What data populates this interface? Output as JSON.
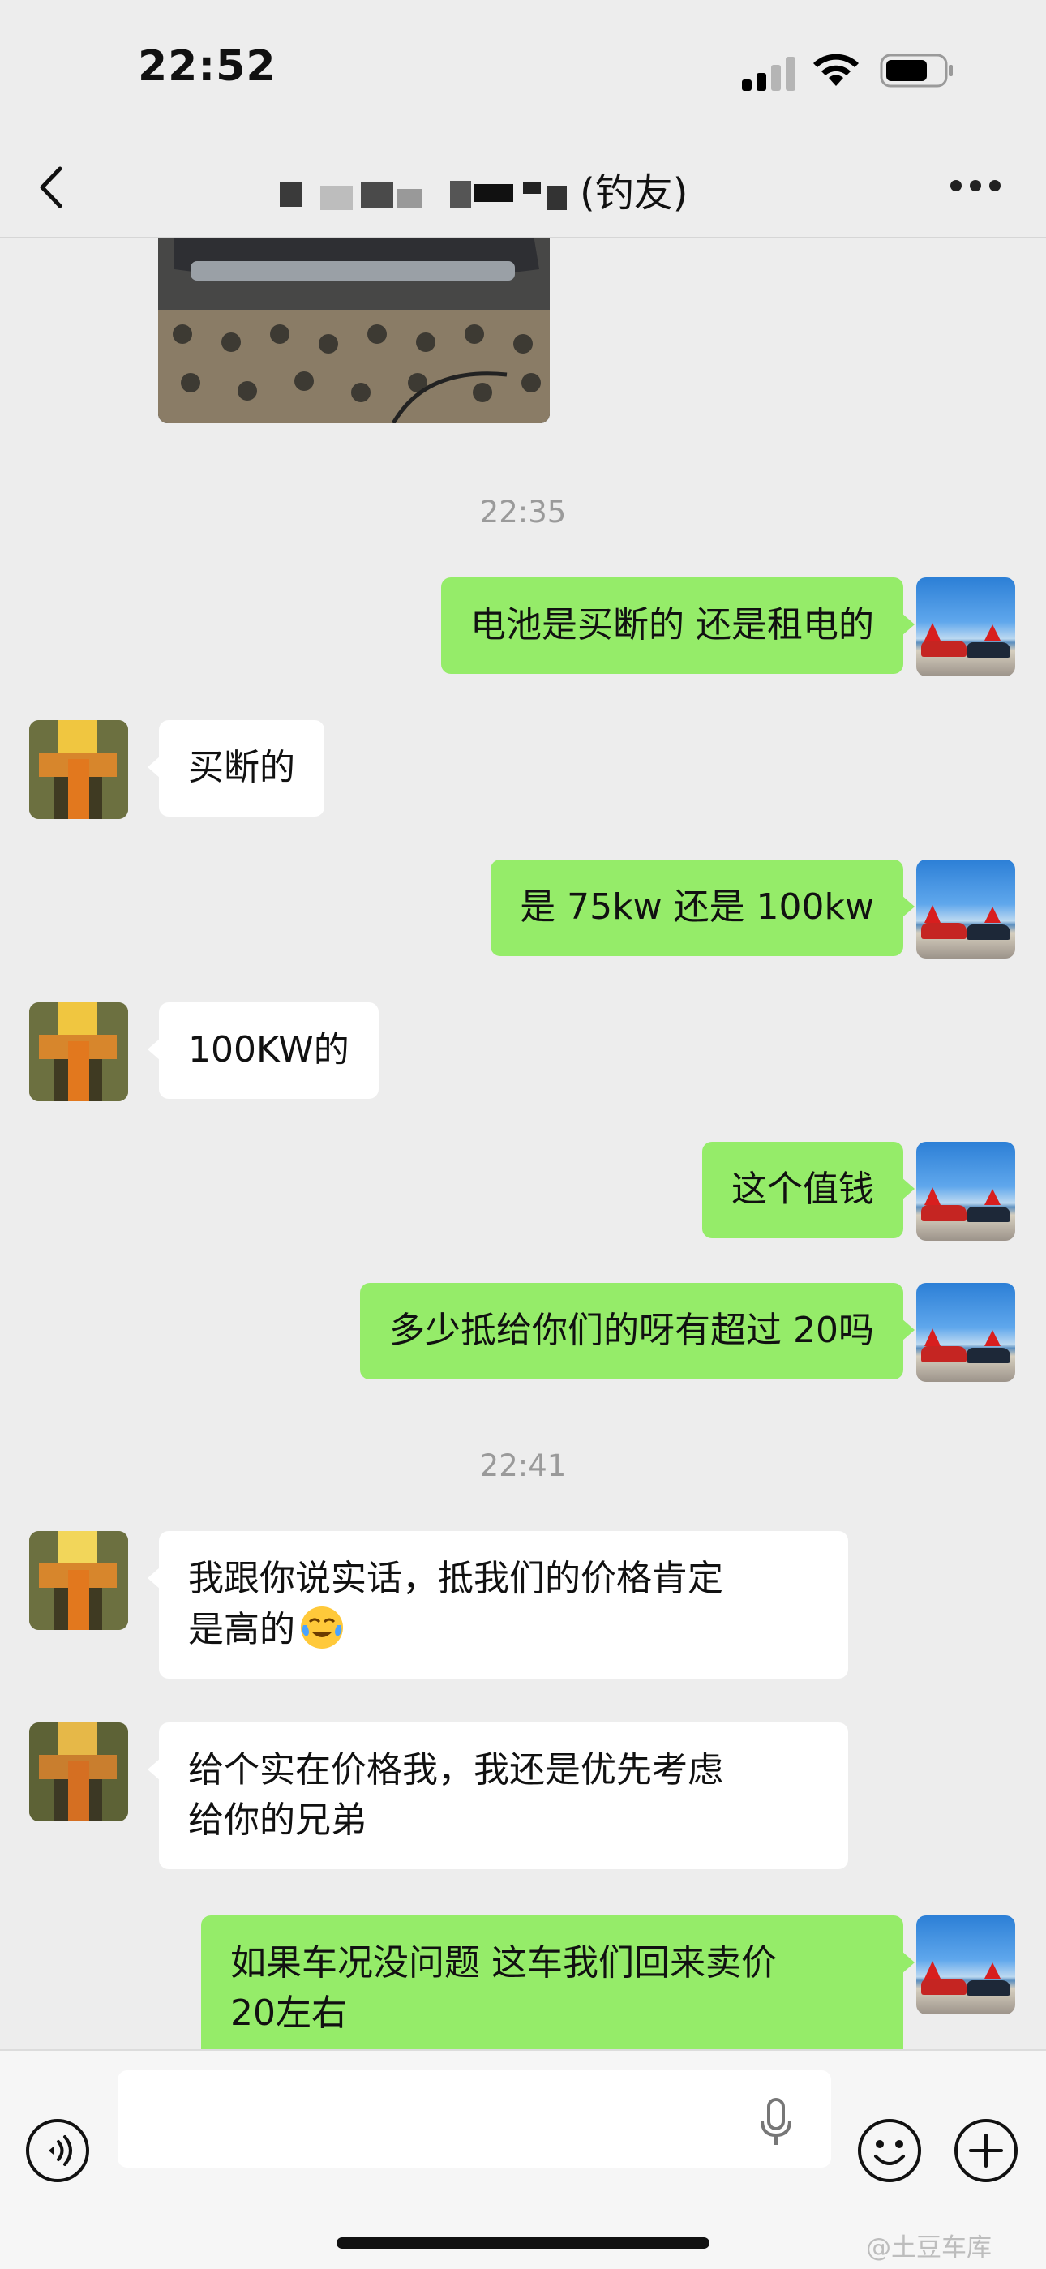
{
  "status_bar": {
    "time": "22:52"
  },
  "header": {
    "title_visible": "(钓友)"
  },
  "messages": {
    "time1": "22:35",
    "m1": "电池是买断的 还是租电的",
    "m2": "买断的",
    "m3": "是 75kw 还是 100kw",
    "m4": "100KW的",
    "m5": "这个值钱",
    "m6": "多少抵给你们的呀有超过 20吗",
    "time2": "22:41",
    "m7": "我跟你说实话，抵我们的价格肯定\n是高的",
    "m8": "给个实在价格我，我还是优先考虑\n给你的兄弟",
    "m9": "如果车况没问题 这车我们回来卖价\n20左右"
  },
  "watermark": "@土豆车库",
  "icons": [
    "back-icon",
    "more-icon",
    "voice-icon",
    "mic-icon",
    "emoji-icon",
    "plus-icon",
    "signal-icon",
    "wifi-icon",
    "battery-icon"
  ],
  "colors": {
    "my_bubble": "#95ec69",
    "other_bubble": "#ffffff",
    "background": "#ededed"
  }
}
